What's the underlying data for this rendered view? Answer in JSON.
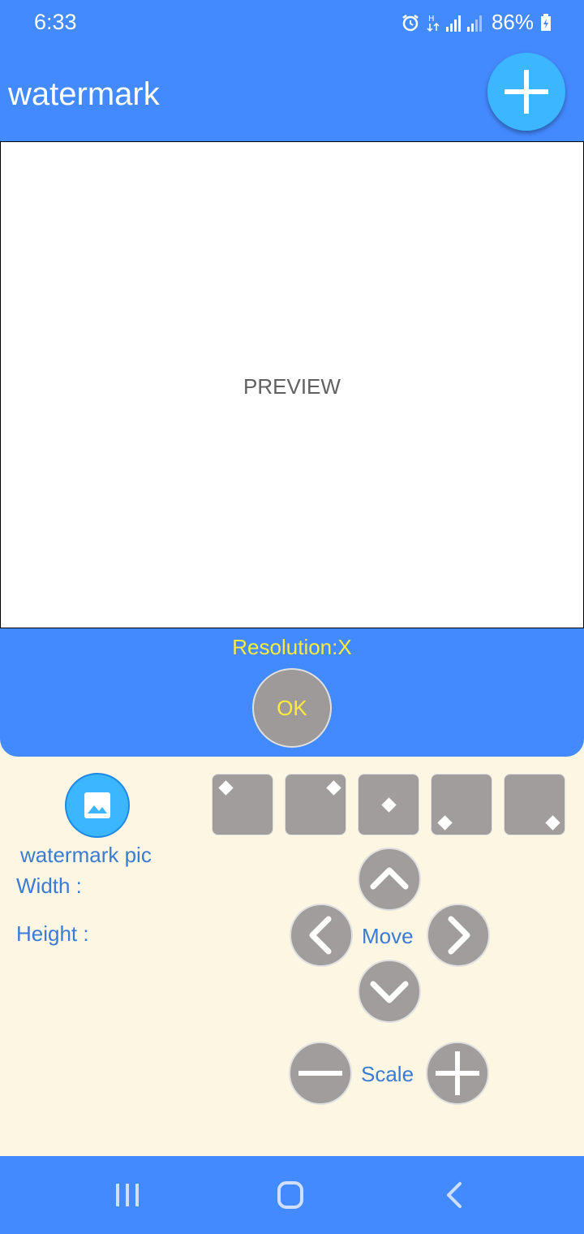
{
  "status_bar": {
    "time": "6:33",
    "battery": "86%",
    "icons": [
      "alarm-icon",
      "data-arrows-icon",
      "signal-icon",
      "battery-charging-icon"
    ]
  },
  "app_bar": {
    "title": "watermark",
    "add_icon": "plus-icon"
  },
  "preview": {
    "label": "PREVIEW"
  },
  "panel": {
    "resolution": "Resolution:X",
    "ok_label": "OK"
  },
  "controls": {
    "watermark_pic_label": "watermark pic",
    "width_label": "Width :",
    "height_label": "Height :",
    "position_buttons": [
      "top-left",
      "top-right",
      "center",
      "bottom-left",
      "bottom-right"
    ],
    "move_label": "Move",
    "scale_label": "Scale"
  },
  "colors": {
    "primary": "#448aff",
    "accent": "#3bb6ff",
    "yellow": "#ffeb3b",
    "panel_bg": "#fdf6e3",
    "button_gray": "#a09d9c",
    "label_blue": "#3a7bd5"
  },
  "nav_bar": {
    "icons": [
      "recent-apps-icon",
      "home-icon",
      "back-icon"
    ]
  }
}
